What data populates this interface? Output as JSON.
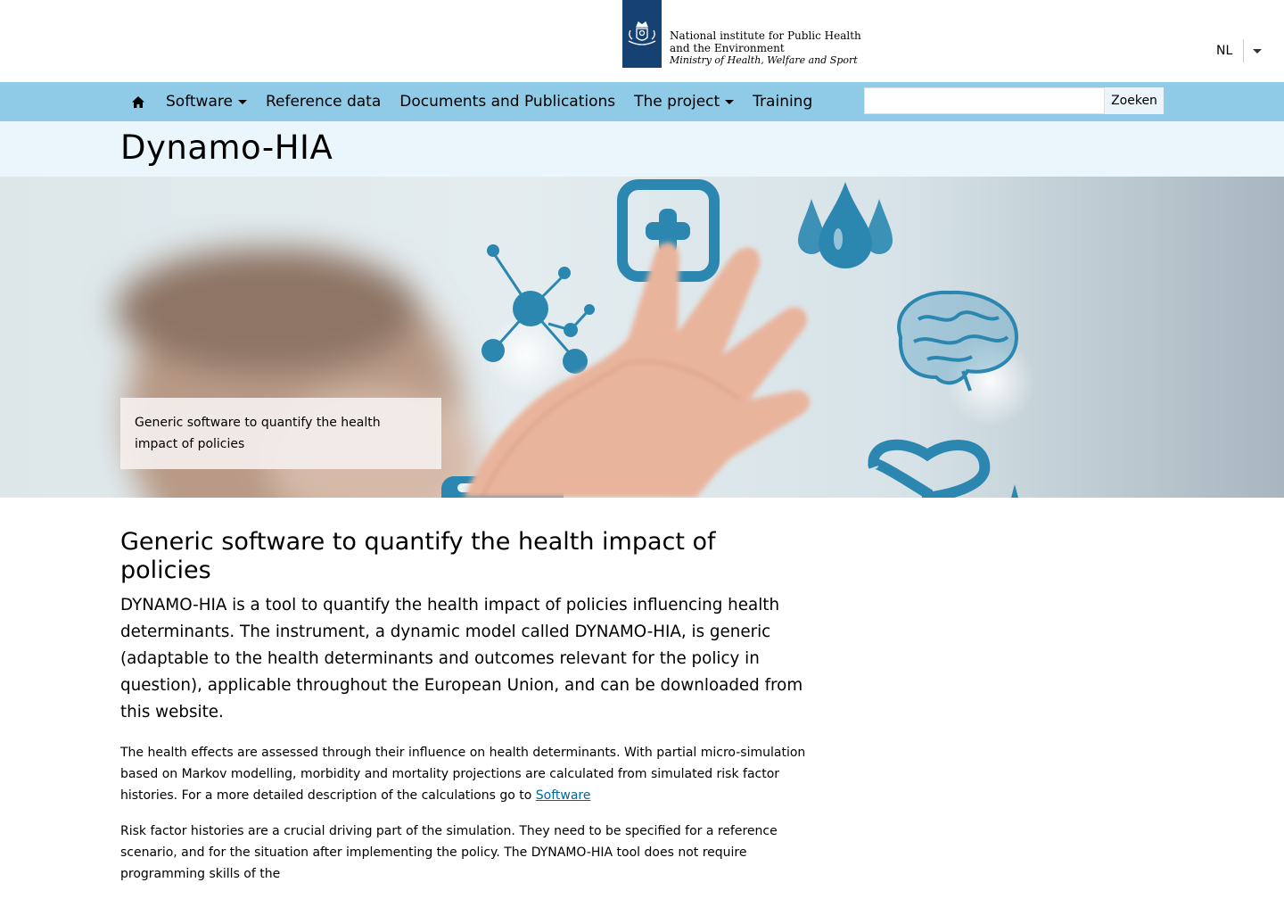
{
  "header": {
    "logo_line1": "National institute for Public Health",
    "logo_line2": "and the Environment",
    "logo_line3": "Ministry of Health, Welfare and Sport",
    "language": "NL"
  },
  "nav": {
    "home_icon": "home-icon",
    "items": [
      {
        "label": "Software",
        "dropdown": true
      },
      {
        "label": "Reference data",
        "dropdown": false
      },
      {
        "label": "Documents and Publications",
        "dropdown": false
      },
      {
        "label": "The project",
        "dropdown": true
      },
      {
        "label": "Training",
        "dropdown": false
      }
    ],
    "search_placeholder": "",
    "search_button": "Zoeken"
  },
  "page": {
    "title": "Dynamo-HIA",
    "hero_caption": "Generic software to quantify the health impact of policies"
  },
  "content": {
    "heading": "Generic software to quantify the health impact of policies",
    "lead": "DYNAMO-HIA is a tool to quantify the health impact of policies influencing health determinants. The instrument, a dynamic model called DYNAMO-HIA, is generic (adaptable to the health determinants and outcomes relevant for the policy in question), applicable throughout the European Union, and can be downloaded from this website.",
    "para1_text": "The health effects are assessed through their influence on health determinants. With partial micro-simulation based on Markov modelling, morbidity and mortality projections are calculated from simulated risk factor histories. For a more detailed description of the calculations go to ",
    "para1_link": "Software",
    "para2": "Risk factor histories are a crucial driving part of the simulation. They need to be specified for a reference scenario, and for the situation after implementing the policy. The DYNAMO-HIA tool does not require programming skills of the"
  },
  "colors": {
    "logo_blue": "#154273",
    "nav_background": "#8fcae7",
    "title_band": "#eaf6fc",
    "link": "#01689b",
    "icon_teal": "#2b87b0"
  }
}
